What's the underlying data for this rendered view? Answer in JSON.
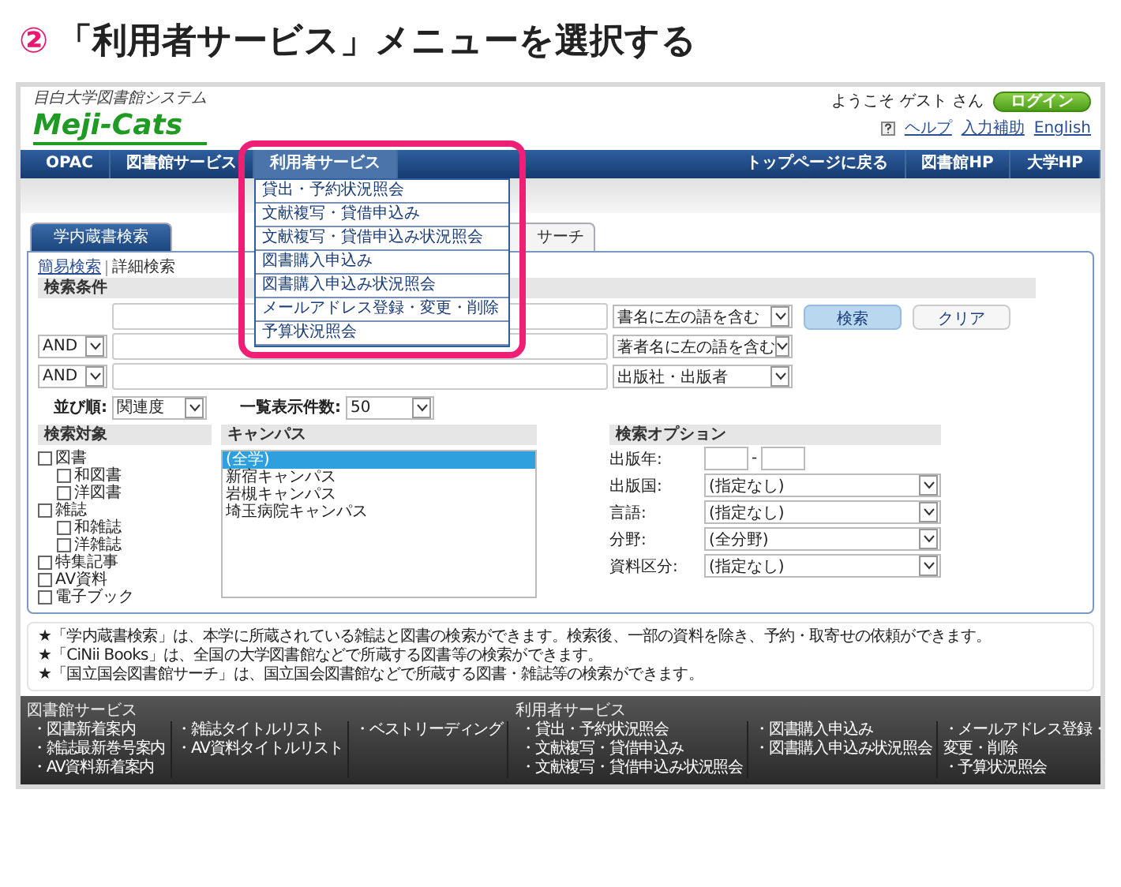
{
  "heading": {
    "number": "②",
    "text": "「利用者サービス」メニューを選択する"
  },
  "header": {
    "system_name": "目白大学図書館システム",
    "logo": "Meji-Cats",
    "welcome": "ようこそ ゲスト さん",
    "login_button": "ログイン",
    "links": [
      {
        "label": "ヘルプ",
        "kind": "help"
      },
      {
        "label": "入力補助",
        "kind": "plain"
      },
      {
        "label": "English",
        "kind": "plain"
      }
    ]
  },
  "nav": {
    "left": [
      {
        "label": "OPAC",
        "selected": false
      },
      {
        "label": "図書館サービス",
        "selected": false
      },
      {
        "label": "利用者サービス",
        "selected": true
      }
    ],
    "right": [
      "トップページに戻る",
      "図書館HP",
      "大学HP"
    ],
    "menu": [
      "貸出・予約状況照会",
      "文献複写・貸借申込み",
      "文献複写・貸借申込み状況照会",
      "図書購入申込み",
      "図書購入申込み状況照会",
      "メールアドレス登録・変更・削除",
      "予算状況照会"
    ]
  },
  "tabs": [
    {
      "label": "学内蔵書検索",
      "selected": true
    },
    {
      "label": "サーチ",
      "selected": false
    }
  ],
  "search_modes": [
    {
      "label": "簡易検索",
      "selected": false
    },
    {
      "label": "詳細検索",
      "selected": true
    }
  ],
  "conditions": {
    "title": "検索条件",
    "rows": [
      {
        "operator": "",
        "field": "書名に左の語を含む"
      },
      {
        "operator": "AND",
        "field": "著者名に左の語を含む"
      },
      {
        "operator": "AND",
        "field": "出版社・出版者"
      }
    ],
    "search_button": "検索",
    "clear_button": "クリア"
  },
  "sort": {
    "label": "並び順:",
    "value": "関連度",
    "count_label": "一覧表示件数:",
    "count_value": "50"
  },
  "targets": {
    "title": "検索対象",
    "items": [
      {
        "label": "図書",
        "checked": false,
        "children": [
          {
            "label": "和図書",
            "checked": false
          },
          {
            "label": "洋図書",
            "checked": false
          }
        ]
      },
      {
        "label": "雑誌",
        "checked": false,
        "children": [
          {
            "label": "和雑誌",
            "checked": false
          },
          {
            "label": "洋雑誌",
            "checked": false
          }
        ]
      },
      {
        "label": "特集記事",
        "checked": false
      },
      {
        "label": "AV資料",
        "checked": false
      },
      {
        "label": "電子ブック",
        "checked": false
      }
    ]
  },
  "campus": {
    "title": "キャンパス",
    "items": [
      {
        "label": "(全学)",
        "selected": true
      },
      {
        "label": "新宿キャンパス",
        "selected": false
      },
      {
        "label": "岩槻キャンパス",
        "selected": false
      },
      {
        "label": "埼玉病院キャンパス",
        "selected": false
      }
    ]
  },
  "options": {
    "title": "検索オプション",
    "year_label": "出版年:",
    "year_separator": "-",
    "selects": [
      {
        "label": "出版国:",
        "value": "(指定なし)"
      },
      {
        "label": "言語:",
        "value": "(指定なし)"
      },
      {
        "label": "分野:",
        "value": "(全分野)"
      },
      {
        "label": "資料区分:",
        "value": "(指定なし)"
      }
    ]
  },
  "notes": [
    "★「学内蔵書検索」は、本学に所蔵されている雑誌と図書の検索ができます。検索後、一部の資料を除き、予約・取寄せの依頼ができます。",
    "★「CiNii Books」は、全国の大学図書館などで所蔵する図書等の検索ができます。",
    "★「国立国会図書館サーチ」は、国立国会図書館などで所蔵する図書・雑誌等の検索ができます。"
  ],
  "footer": [
    {
      "title": "図書館サービス",
      "columns": [
        [
          "・図書新着案内",
          "・雑誌最新巻号案内",
          "・AV資料新着案内"
        ],
        [
          "・雑誌タイトルリスト",
          "・AV資料タイトルリスト"
        ],
        [
          "・ベストリーディング"
        ]
      ]
    },
    {
      "title": "利用者サービス",
      "columns": [
        [
          "・貸出・予約状況照会",
          "・文献複写・貸借申込み",
          "・文献複写・貸借申込み状況照会"
        ],
        [
          "・図書購入申込み",
          "・図書購入申込み状況照会"
        ],
        [
          "・メールアドレス登録・変更・削除",
          "・予算状況照会"
        ]
      ]
    }
  ]
}
